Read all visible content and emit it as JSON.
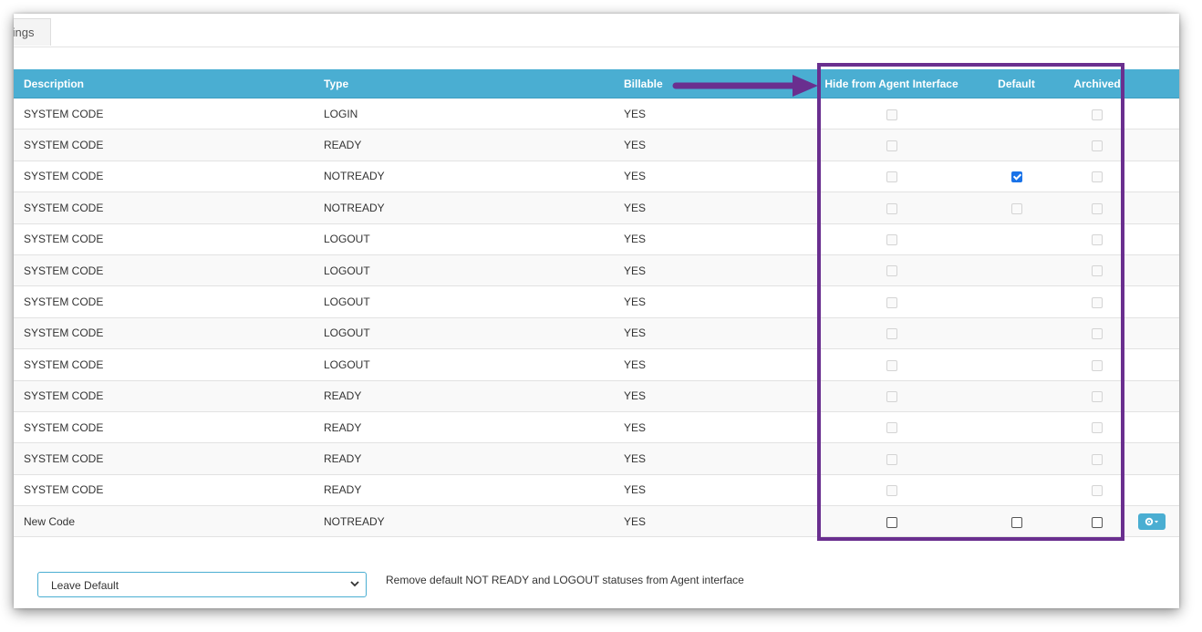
{
  "tabs": [
    {
      "label": "tings"
    }
  ],
  "table": {
    "columns": {
      "description": "Description",
      "type": "Type",
      "billable": "Billable",
      "hide": "Hide from Agent Interface",
      "default": "Default",
      "archived": "Archived"
    },
    "rows": [
      {
        "description": "SYSTEM CODE",
        "type": "LOGIN",
        "billable": "YES",
        "hide": "disabled",
        "default": "none",
        "archived": "disabled"
      },
      {
        "description": "SYSTEM CODE",
        "type": "READY",
        "billable": "YES",
        "hide": "disabled",
        "default": "none",
        "archived": "disabled"
      },
      {
        "description": "SYSTEM CODE",
        "type": "NOTREADY",
        "billable": "YES",
        "hide": "disabled",
        "default": "checked",
        "archived": "disabled"
      },
      {
        "description": "SYSTEM CODE",
        "type": "NOTREADY",
        "billable": "YES",
        "hide": "disabled",
        "default": "disabled",
        "archived": "disabled"
      },
      {
        "description": "SYSTEM CODE",
        "type": "LOGOUT",
        "billable": "YES",
        "hide": "disabled",
        "default": "none",
        "archived": "disabled"
      },
      {
        "description": "SYSTEM CODE",
        "type": "LOGOUT",
        "billable": "YES",
        "hide": "disabled",
        "default": "none",
        "archived": "disabled"
      },
      {
        "description": "SYSTEM CODE",
        "type": "LOGOUT",
        "billable": "YES",
        "hide": "disabled",
        "default": "none",
        "archived": "disabled"
      },
      {
        "description": "SYSTEM CODE",
        "type": "LOGOUT",
        "billable": "YES",
        "hide": "disabled",
        "default": "none",
        "archived": "disabled"
      },
      {
        "description": "SYSTEM CODE",
        "type": "LOGOUT",
        "billable": "YES",
        "hide": "disabled",
        "default": "none",
        "archived": "disabled"
      },
      {
        "description": "SYSTEM CODE",
        "type": "READY",
        "billable": "YES",
        "hide": "disabled",
        "default": "none",
        "archived": "disabled"
      },
      {
        "description": "SYSTEM CODE",
        "type": "READY",
        "billable": "YES",
        "hide": "disabled",
        "default": "none",
        "archived": "disabled"
      },
      {
        "description": "SYSTEM CODE",
        "type": "READY",
        "billable": "YES",
        "hide": "disabled",
        "default": "none",
        "archived": "disabled"
      },
      {
        "description": "SYSTEM CODE",
        "type": "READY",
        "billable": "YES",
        "hide": "disabled",
        "default": "none",
        "archived": "disabled"
      },
      {
        "description": "New Code",
        "type": "NOTREADY",
        "billable": "YES",
        "hide": "enabled",
        "default": "enabled",
        "archived": "enabled",
        "has_actions": true
      }
    ]
  },
  "actions_button": {
    "icon": "gear-icon"
  },
  "footer": {
    "select_value": "Leave Default",
    "help_text": "Remove default NOT READY and LOGOUT statuses from Agent interface"
  },
  "colors": {
    "header_bg": "#4aaed2",
    "highlight": "#6a2f8f",
    "checkbox_checked": "#1a73e8"
  }
}
